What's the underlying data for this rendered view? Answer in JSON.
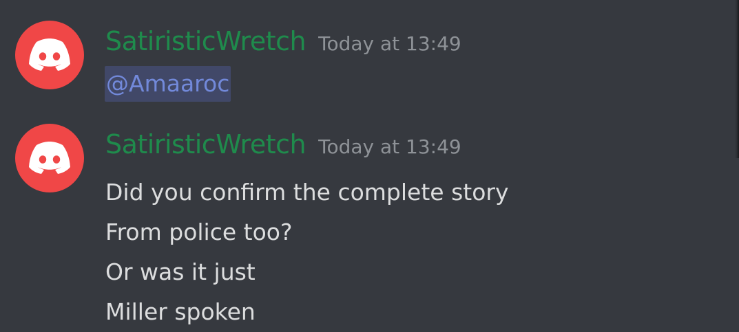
{
  "colors": {
    "background": "#36393f",
    "username": "#1f8b4c",
    "timestamp": "#8e9297",
    "mention_text": "#7289da",
    "mention_bg": "#414868",
    "message_text": "#dcddde",
    "avatar_bg": "#f04747"
  },
  "messages": [
    {
      "avatar_icon": "discord-logo-icon",
      "username": "SatiristicWretch",
      "timestamp": "Today at 13:49",
      "mention": "@Amaaroc"
    },
    {
      "avatar_icon": "discord-logo-icon",
      "username": "SatiristicWretch",
      "timestamp": "Today at 13:49",
      "lines": [
        "Did you confirm the complete story",
        "From police too?",
        "Or was it just",
        "Miller spoken"
      ]
    }
  ]
}
